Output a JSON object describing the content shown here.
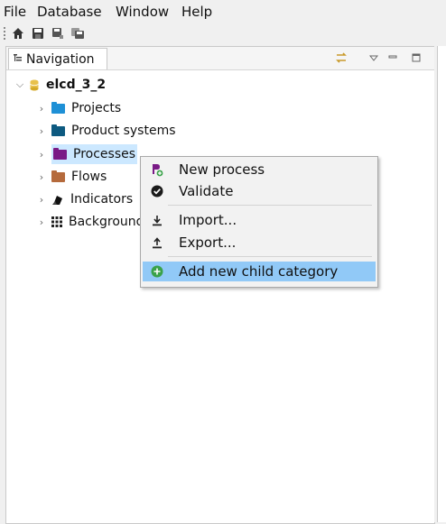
{
  "menubar": [
    "File",
    "Database",
    "Window",
    "Help"
  ],
  "toolbar": {
    "buttons": [
      {
        "name": "home-icon"
      },
      {
        "name": "save-icon"
      },
      {
        "name": "save-as-icon"
      },
      {
        "name": "save-all-icon"
      }
    ]
  },
  "view": {
    "tab_label": "Navigation",
    "controls": [
      "link-with-editor-icon",
      "view-menu-icon",
      "minimize-icon",
      "maximize-icon"
    ]
  },
  "tree": {
    "root": {
      "label": "elcd_3_2",
      "expanded": true,
      "icon": "database-icon"
    },
    "items": [
      {
        "label": "Projects",
        "icon": "folder-icon",
        "color": "#1e90d6"
      },
      {
        "label": "Product systems",
        "icon": "folder-icon",
        "color": "#0d5a80"
      },
      {
        "label": "Processes",
        "icon": "folder-icon",
        "color": "#7a1a86",
        "selected": true
      },
      {
        "label": "Flows",
        "icon": "folder-icon",
        "color": "#b56a3c"
      },
      {
        "label": "Indicators",
        "icon": "indicators-icon"
      },
      {
        "label": "Background",
        "icon": "grid-icon"
      }
    ]
  },
  "context_menu": {
    "items": [
      {
        "label": "New process",
        "icon": "new-process-icon"
      },
      {
        "label": "Validate",
        "icon": "validate-icon"
      },
      {
        "label": "Import...",
        "icon": "import-icon"
      },
      {
        "label": "Export...",
        "icon": "export-icon"
      },
      {
        "label": "Add new child category",
        "icon": "add-category-icon",
        "highlighted": true
      }
    ]
  },
  "colors": {
    "selection": "#cce8ff",
    "menu_highlight": "#91c9f7",
    "root_icon": "#e8c14c"
  }
}
